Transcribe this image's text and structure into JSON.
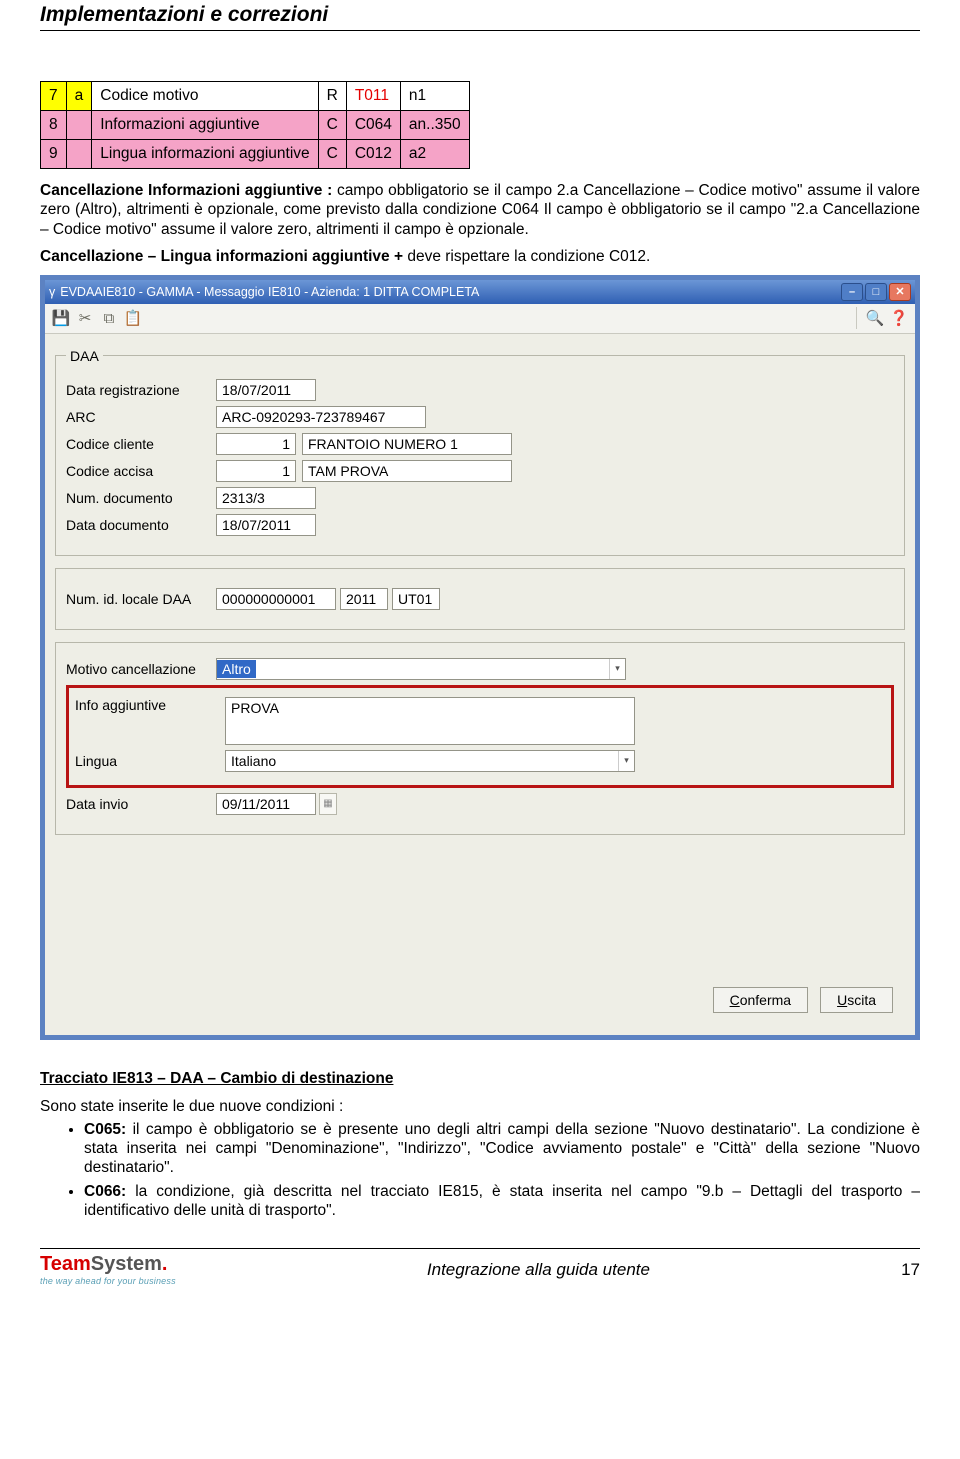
{
  "docTitle": "Implementazioni e correzioni",
  "table": {
    "rows": [
      {
        "n": "7",
        "sub": "a",
        "desc": "Codice motivo",
        "req": "R",
        "code": "T011",
        "fmt": "n1",
        "codeRed": true,
        "pink": false
      },
      {
        "n": "8",
        "sub": "",
        "desc": "Informazioni aggiuntive",
        "req": "C",
        "code": "C064",
        "fmt": "an..350",
        "codeRed": false,
        "pink": true
      },
      {
        "n": "9",
        "sub": "",
        "desc": "Lingua informazioni aggiuntive",
        "req": "C",
        "code": "C012",
        "fmt": "a2",
        "codeRed": false,
        "pink": true
      }
    ]
  },
  "para1_lead": "Cancellazione Informazioni aggiuntive :",
  "para1_rest": " campo obbligatorio se il campo 2.a Cancellazione – Codice motivo\" assume il valore zero (Altro), altrimenti è opzionale, come previsto dalla condizione C064 Il campo è obbligatorio se il campo \"2.a Cancellazione – Codice motivo\" assume il valore zero, altrimenti il campo è opzionale.",
  "para2_lead": "Cancellazione – Lingua informazioni aggiuntive + ",
  "para2_rest": "deve rispettare la condizione C012.",
  "win": {
    "title": "EVDAAIE810 - GAMMA - Messaggio IE810 - Azienda:   1 DITTA COMPLETA",
    "groupDAA": "DAA",
    "labels": {
      "dataReg": "Data registrazione",
      "arc": "ARC",
      "codCliente": "Codice cliente",
      "codAccisa": "Codice accisa",
      "numDoc": "Num. documento",
      "dataDoc": "Data documento",
      "numIdLocale": "Num. id. locale DAA",
      "motivo": "Motivo cancellazione",
      "info": "Info aggiuntive",
      "lingua": "Lingua",
      "dataInvio": "Data invio"
    },
    "values": {
      "dataReg": "18/07/2011",
      "arc": "ARC-0920293-723789467",
      "codCliente": "1",
      "cliente": "FRANTOIO NUMERO 1",
      "codAccisa": "1",
      "accisa": "TAM PROVA",
      "numDoc": "2313/3",
      "dataDoc": "18/07/2011",
      "id1": "000000000001",
      "id2": "2011",
      "id3": "UT01",
      "motivo": "Altro",
      "info": "PROVA",
      "lingua": "Italiano",
      "dataInvio": "09/11/2011"
    },
    "buttons": {
      "conferma": "Conferma",
      "uscita": "Uscita"
    }
  },
  "section2": {
    "heading": "Tracciato IE813 – DAA – Cambio di destinazione",
    "intro": "Sono state inserite le due nuove condizioni :",
    "b1_lead": "C065:",
    "b1_text": " il campo è obbligatorio se è presente uno degli altri campi della sezione \"Nuovo destinatario\". La condizione è stata inserita nei campi \"Denominazione\", \"Indirizzo\", \"Codice avviamento postale\" e \"Città\" della sezione \"Nuovo destinatario\".",
    "b2_lead": "C066:",
    "b2_text": " la condizione, già descritta nel tracciato IE815, è stata inserita nel campo \"9.b – Dettagli del trasporto – identificativo delle unità di trasporto\"."
  },
  "footer": {
    "logo1": "Team",
    "logo2": "System",
    "logoDot": ".",
    "tagline": "the way ahead for your business",
    "center": "Integrazione alla guida utente",
    "page": "17"
  }
}
